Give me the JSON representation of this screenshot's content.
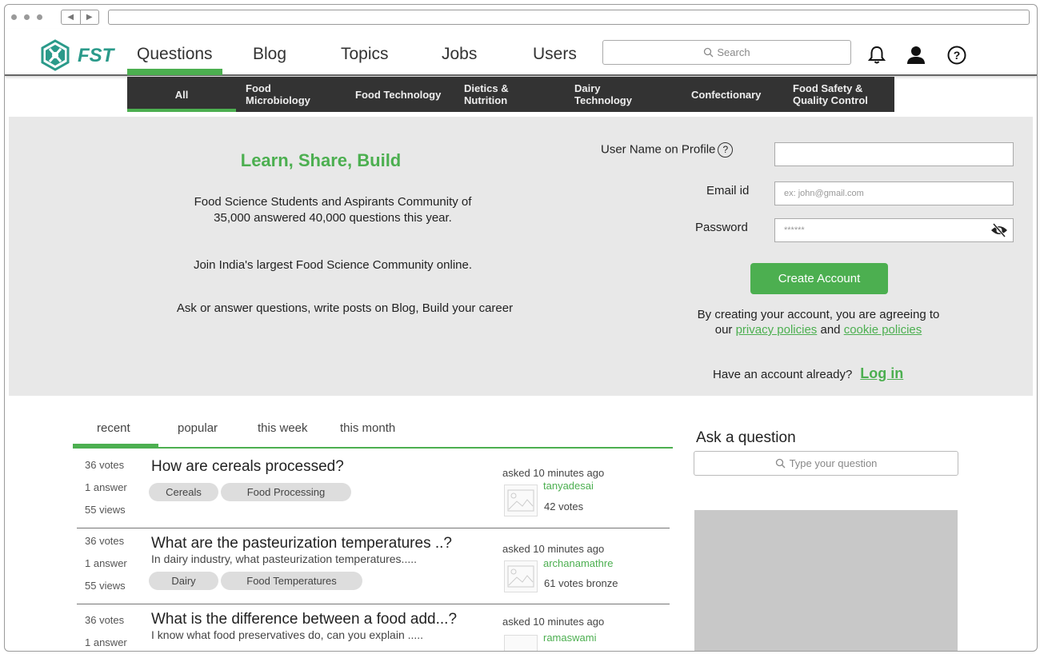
{
  "logo": {
    "text": "FST"
  },
  "nav": [
    {
      "label": "Questions"
    },
    {
      "label": "Blog"
    },
    {
      "label": "Topics"
    },
    {
      "label": "Jobs"
    },
    {
      "label": "Users"
    }
  ],
  "search": {
    "placeholder": "Search"
  },
  "categories": [
    {
      "label": "All"
    },
    {
      "label": "Food Microbiology"
    },
    {
      "label": "Food Technology"
    },
    {
      "label": "Dietics & Nutrition"
    },
    {
      "label": "Dairy Technology"
    },
    {
      "label": "Confectionary"
    },
    {
      "label": "Food Safety & Quality Control"
    }
  ],
  "hero": {
    "title": "Learn, Share, Build",
    "line1": "Food Science Students and Aspirants Community of",
    "line2": "35,000 answered 40,000 questions this year.",
    "line3": "Join India's largest Food Science Community online.",
    "line4": "Ask or answer questions, write posts on Blog, Build your career"
  },
  "signup": {
    "username_label": "User Name on Profile",
    "email_label": "Email id",
    "email_placeholder": "ex: john@gmail.com",
    "password_label": "Password",
    "password_value": "******",
    "create_label": "Create Account",
    "agree_text": "By creating your account, you are agreeing to",
    "our": "our",
    "privacy": "privacy policies",
    "and": "and",
    "cookie": "cookie policies",
    "have_account": "Have an account already?",
    "login": "Log in"
  },
  "tabs": [
    {
      "label": "recent"
    },
    {
      "label": "popular"
    },
    {
      "label": "this week"
    },
    {
      "label": "this month"
    }
  ],
  "questions": [
    {
      "votes": "36 votes",
      "answers": "1 answer",
      "views": "55 views",
      "title": "How are cereals processed?",
      "excerpt": "",
      "tags": [
        "Cereals",
        "Food Processing"
      ],
      "asked": "asked 10 minutes ago",
      "user": "tanyadesai",
      "user_votes": "42 votes"
    },
    {
      "votes": "36 votes",
      "answers": "1 answer",
      "views": "55 views",
      "title": "What are the pasteurization temperatures ..?",
      "excerpt": "In dairy industry, what pasteurization temperatures.....",
      "tags": [
        "Dairy",
        "Food Temperatures"
      ],
      "asked": "asked 10 minutes ago",
      "user": "archanamathre",
      "user_votes": "61 votes  bronze"
    },
    {
      "votes": "36 votes",
      "answers": "1 answer",
      "views": "",
      "title": "What is the difference between a food add...?",
      "excerpt": "I know what food preservatives do, can you explain .....",
      "tags": [],
      "asked": "asked 10 minutes ago",
      "user": "ramaswami",
      "user_votes": ""
    }
  ],
  "ask": {
    "title": "Ask a question",
    "placeholder": "Type your question"
  }
}
